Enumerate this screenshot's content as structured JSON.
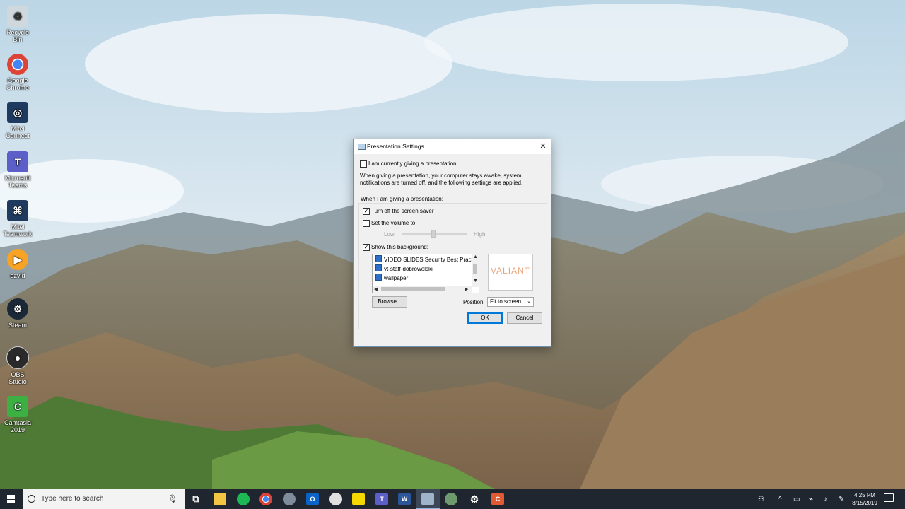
{
  "desktop_icons": [
    {
      "label": "Recycle Bin",
      "icon": "recycle-bin-icon",
      "color": "#cfd8dc"
    },
    {
      "label": "Google Chrome",
      "icon": "chrome-icon",
      "color": "#4285f4"
    },
    {
      "label": "Mitel Connect",
      "icon": "mitel-connect-icon",
      "color": "#1e3a5f"
    },
    {
      "label": "Microsoft Teams",
      "icon": "teams-icon",
      "color": "#5b5fc7"
    },
    {
      "label": "Mitel Teamwork",
      "icon": "mitel-teamwork-icon",
      "color": "#1e3a5f"
    },
    {
      "label": "ezvid",
      "icon": "ezvid-icon",
      "color": "#f7a325"
    },
    {
      "label": "Steam",
      "icon": "steam-icon",
      "color": "#1b2838"
    },
    {
      "label": "OBS Studio",
      "icon": "obs-icon",
      "color": "#2a2a2a"
    },
    {
      "label": "Camtasia 2019",
      "icon": "camtasia-icon",
      "color": "#3cb043"
    }
  ],
  "dialog": {
    "title": "Presentation Settings",
    "close_glyph": "✕",
    "giving_presentation_label": "I am currently giving a presentation",
    "description": "When giving a presentation, your computer stays awake, system notifications are turned off, and the following settings are applied.",
    "group_label": "When I am giving a presentation:",
    "screen_saver_label": "Turn off the screen saver",
    "volume_label": "Set the volume to:",
    "volume_low": "Low",
    "volume_high": "High",
    "background_label": "Show this background:",
    "background_list": [
      "VIDEO SLIDES Security Best Practice",
      "vt-staff-dobrowolski",
      "wallpaper"
    ],
    "preview_text": "VALIANT",
    "browse_label": "Browse...",
    "position_label": "Position:",
    "position_value": "Fit to screen",
    "ok_label": "OK",
    "cancel_label": "Cancel",
    "checked_glyph": "✓"
  },
  "taskbar": {
    "search_placeholder": "Type here to search",
    "apps": [
      {
        "name": "task-view-icon",
        "glyph": "⧉",
        "color": "#1f2630"
      },
      {
        "name": "file-explorer-icon",
        "glyph": "",
        "color": "#f4c542"
      },
      {
        "name": "spotify-icon",
        "glyph": "",
        "color": "#1db954"
      },
      {
        "name": "chrome-icon",
        "glyph": "",
        "color": "#4285f4"
      },
      {
        "name": "app-icon",
        "glyph": "",
        "color": "#7f8c9b"
      },
      {
        "name": "outlook-icon",
        "glyph": "O",
        "color": "#0a64c8"
      },
      {
        "name": "xbox-icon",
        "glyph": "",
        "color": "#e0e0e0"
      },
      {
        "name": "sticky-notes-icon",
        "glyph": "",
        "color": "#f5d800"
      },
      {
        "name": "teams-icon",
        "glyph": "T",
        "color": "#5b5fc7"
      },
      {
        "name": "word-icon",
        "glyph": "W",
        "color": "#2b579a"
      },
      {
        "name": "presentation-settings-icon",
        "glyph": "",
        "color": "#9fb4c8"
      },
      {
        "name": "app-icon-2",
        "glyph": "",
        "color": "#6d9b6d"
      },
      {
        "name": "settings-icon",
        "glyph": "⚙",
        "color": "#1f2630"
      },
      {
        "name": "camtasia-icon",
        "glyph": "C",
        "color": "#e05a33"
      }
    ],
    "tray": [
      "person-icon",
      "chevron-up-icon",
      "battery-icon",
      "power-icon",
      "wifi-icon",
      "volume-icon",
      "pen-icon",
      "ime-icon"
    ],
    "time": "4:25 PM",
    "date": "8/15/2019"
  }
}
